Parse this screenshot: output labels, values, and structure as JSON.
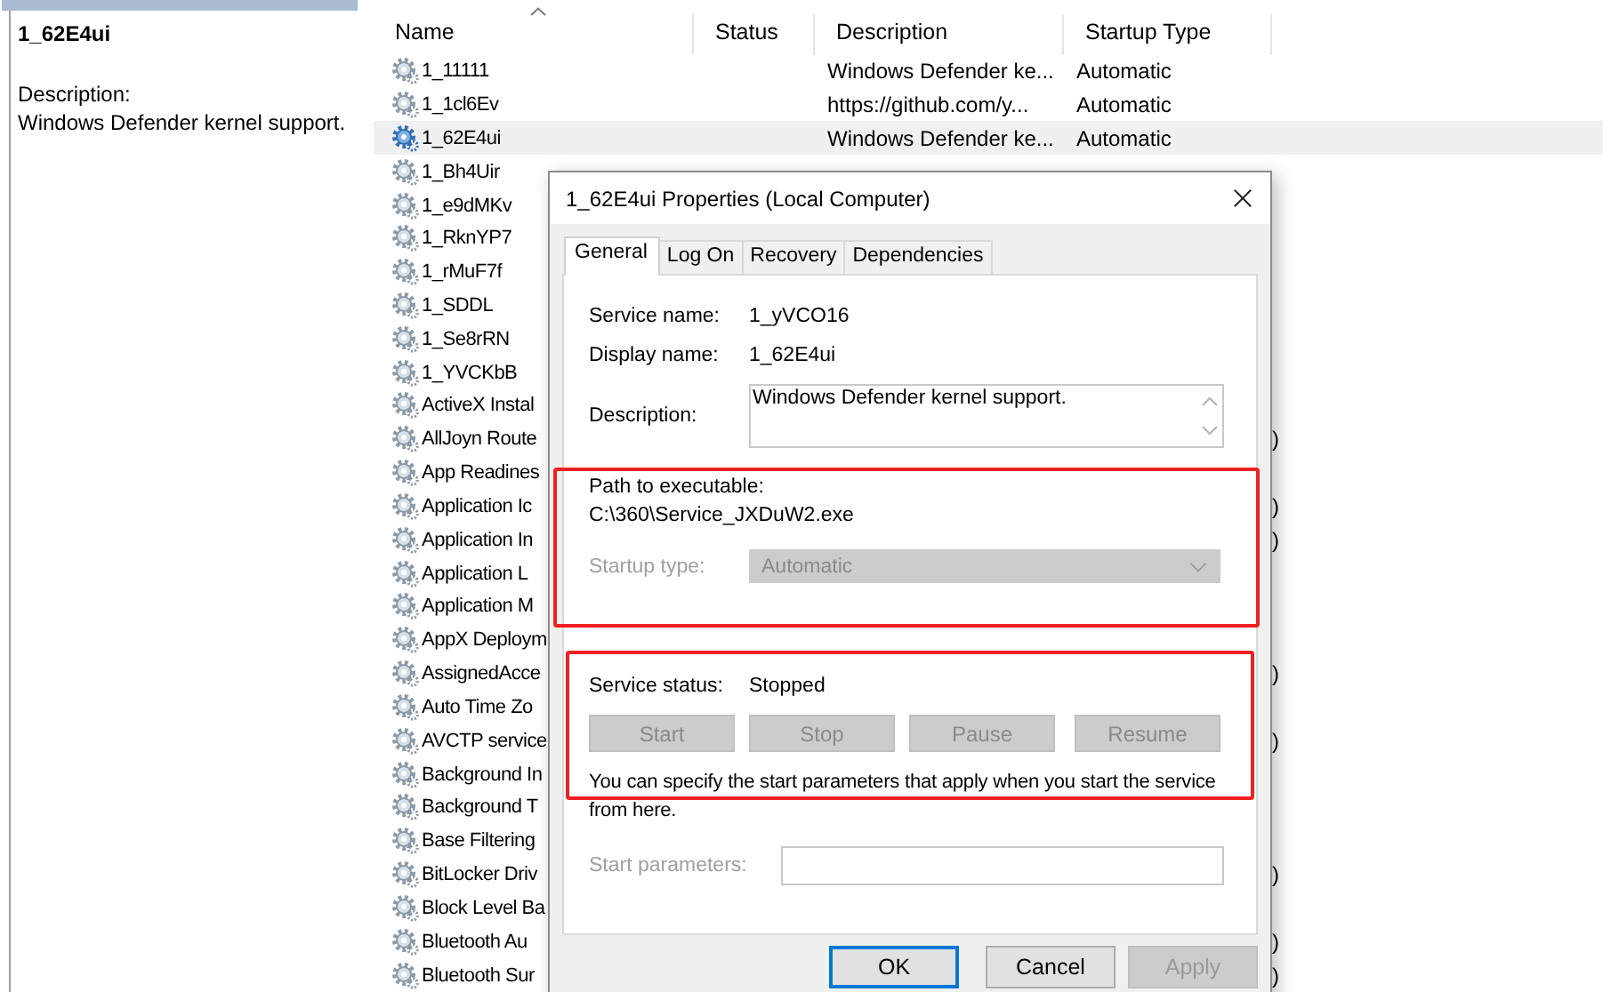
{
  "left_pane": {
    "title": "1_62E4ui",
    "description_label": "Description:",
    "description": "Windows Defender kernel support."
  },
  "services": {
    "columns": [
      {
        "label": "Name",
        "sorted": true
      },
      {
        "label": "Status",
        "sorted": false
      },
      {
        "label": "Description",
        "sorted": false
      },
      {
        "label": "Startup Type",
        "sorted": false
      }
    ],
    "rows": [
      {
        "name": "1_11111",
        "description": "Windows Defender ke...",
        "startup_type": "Automatic",
        "selected": false
      },
      {
        "name": "1_1cl6Ev",
        "description": "https://github.com/y...",
        "startup_type": "Automatic",
        "selected": false
      },
      {
        "name": "1_62E4ui",
        "description": "Windows Defender ke...",
        "startup_type": "Automatic",
        "selected": true
      },
      {
        "name": "1_Bh4Uir",
        "selected": false
      },
      {
        "name": "1_e9dMKv",
        "selected": false
      },
      {
        "name": "1_RknYP7",
        "selected": false
      },
      {
        "name": "1_rMuF7f",
        "selected": false
      },
      {
        "name": "1_SDDL",
        "selected": false
      },
      {
        "name": "1_Se8rRN",
        "selected": false
      },
      {
        "name": "1_YVCKbB",
        "selected": false
      },
      {
        "name": "ActiveX Instal",
        "selected": false
      },
      {
        "name": "AllJoyn Route",
        "tail": ")",
        "selected": false
      },
      {
        "name": "App Readines",
        "selected": false
      },
      {
        "name": "Application Ic",
        "tail": ")",
        "selected": false
      },
      {
        "name": "Application In",
        "tail": ")",
        "selected": false
      },
      {
        "name": "Application L",
        "selected": false
      },
      {
        "name": "Application M",
        "selected": false
      },
      {
        "name": "AppX Deploym",
        "selected": false
      },
      {
        "name": "AssignedAcce",
        "tail": ")",
        "selected": false
      },
      {
        "name": "Auto Time Zo",
        "selected": false
      },
      {
        "name": "AVCTP service",
        "tail": ")",
        "selected": false
      },
      {
        "name": "Background In",
        "selected": false
      },
      {
        "name": "Background T",
        "selected": false
      },
      {
        "name": "Base Filtering",
        "selected": false
      },
      {
        "name": "BitLocker Driv",
        "tail": ")",
        "selected": false
      },
      {
        "name": "Block Level Ba",
        "selected": false
      },
      {
        "name": "Bluetooth Au",
        "tail": ")",
        "selected": false
      },
      {
        "name": "Bluetooth Sur",
        "tail": ")",
        "selected": false
      }
    ]
  },
  "dialog": {
    "title": "1_62E4ui Properties (Local Computer)",
    "tabs": [
      {
        "label": "General",
        "selected": true
      },
      {
        "label": "Log On",
        "selected": false
      },
      {
        "label": "Recovery",
        "selected": false
      },
      {
        "label": "Dependencies",
        "selected": false
      }
    ],
    "service_name": {
      "label": "Service name:",
      "value": "1_yVCO16"
    },
    "display_name": {
      "label": "Display name:",
      "value": "1_62E4ui"
    },
    "description": {
      "label": "Description:",
      "value": "Windows Defender kernel support."
    },
    "path": {
      "label": "Path to executable:",
      "value": "C:\\360\\Service_JXDuW2.exe"
    },
    "startup_type": {
      "label": "Startup type:",
      "value": "Automatic",
      "disabled": true
    },
    "service_status": {
      "label": "Service status:",
      "value": "Stopped"
    },
    "control_buttons": [
      {
        "label": "Start",
        "disabled": true
      },
      {
        "label": "Stop",
        "disabled": true
      },
      {
        "label": "Pause",
        "disabled": true
      },
      {
        "label": "Resume",
        "disabled": true
      }
    ],
    "note": "You can specify the start parameters that apply when you start the service from here.",
    "start_parameters": {
      "label": "Start parameters:",
      "disabled": true
    },
    "buttons": [
      {
        "label": "OK",
        "default": true,
        "disabled": false
      },
      {
        "label": "Cancel",
        "default": false,
        "disabled": false
      },
      {
        "label": "Apply",
        "default": false,
        "disabled": true
      }
    ]
  }
}
